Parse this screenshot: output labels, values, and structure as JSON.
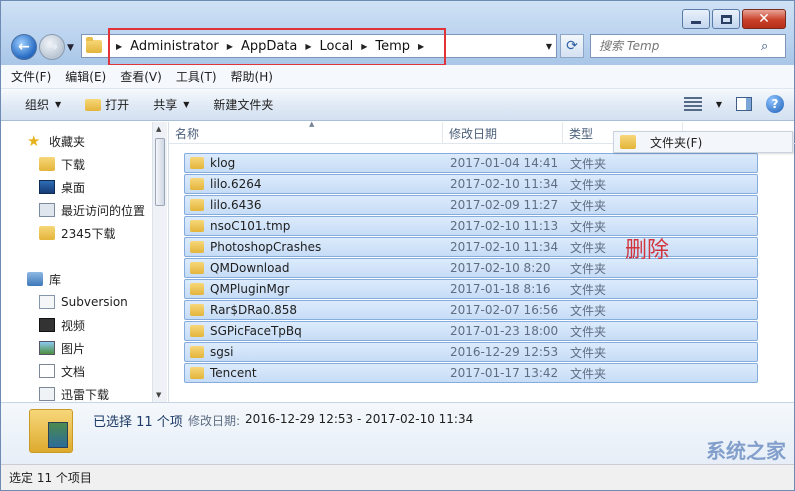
{
  "address": {
    "crumbs": [
      "Administrator",
      "AppData",
      "Local",
      "Temp"
    ]
  },
  "search": {
    "placeholder": "搜索 Temp"
  },
  "menu": [
    "文件(F)",
    "编辑(E)",
    "查看(V)",
    "工具(T)",
    "帮助(H)"
  ],
  "toolbar": {
    "organize": "组织",
    "open": "打开",
    "share": "共享",
    "new_folder": "新建文件夹"
  },
  "nav": {
    "favorites": "收藏夹",
    "downloads": "下载",
    "desktop": "桌面",
    "recent": "最近访问的位置",
    "dl2345": "2345下载",
    "library": "库",
    "subversion": "Subversion",
    "videos": "视频",
    "pictures": "图片",
    "documents": "文档",
    "xunlei": "迅雷下载"
  },
  "columns": {
    "name": "名称",
    "date": "修改日期",
    "type": "类型"
  },
  "context_menu": {
    "label": "文件夹(F)"
  },
  "files": [
    {
      "name": "klog",
      "date": "2017-01-04 14:41",
      "type": "文件夹"
    },
    {
      "name": "lilo.6264",
      "date": "2017-02-10 11:34",
      "type": "文件夹"
    },
    {
      "name": "lilo.6436",
      "date": "2017-02-09 11:27",
      "type": "文件夹"
    },
    {
      "name": "nsoC101.tmp",
      "date": "2017-02-10 11:13",
      "type": "文件夹"
    },
    {
      "name": "PhotoshopCrashes",
      "date": "2017-02-10 11:34",
      "type": "文件夹"
    },
    {
      "name": "QMDownload",
      "date": "2017-02-10 8:20",
      "type": "文件夹"
    },
    {
      "name": "QMPluginMgr",
      "date": "2017-01-18 8:16",
      "type": "文件夹"
    },
    {
      "name": "Rar$DRa0.858",
      "date": "2017-02-07 16:56",
      "type": "文件夹"
    },
    {
      "name": "SGPicFaceTpBq",
      "date": "2017-01-23 18:00",
      "type": "文件夹"
    },
    {
      "name": "sgsi",
      "date": "2016-12-29 12:53",
      "type": "文件夹"
    },
    {
      "name": "Tencent",
      "date": "2017-01-17 13:42",
      "type": "文件夹"
    }
  ],
  "annotation": "删除",
  "details": {
    "selected": "已选择 11 个项",
    "modified_label": "修改日期:",
    "modified_range": "2016-12-29 12:53 - 2017-02-10 11:34"
  },
  "status": "选定 11 个项目",
  "watermark": "系统之家"
}
